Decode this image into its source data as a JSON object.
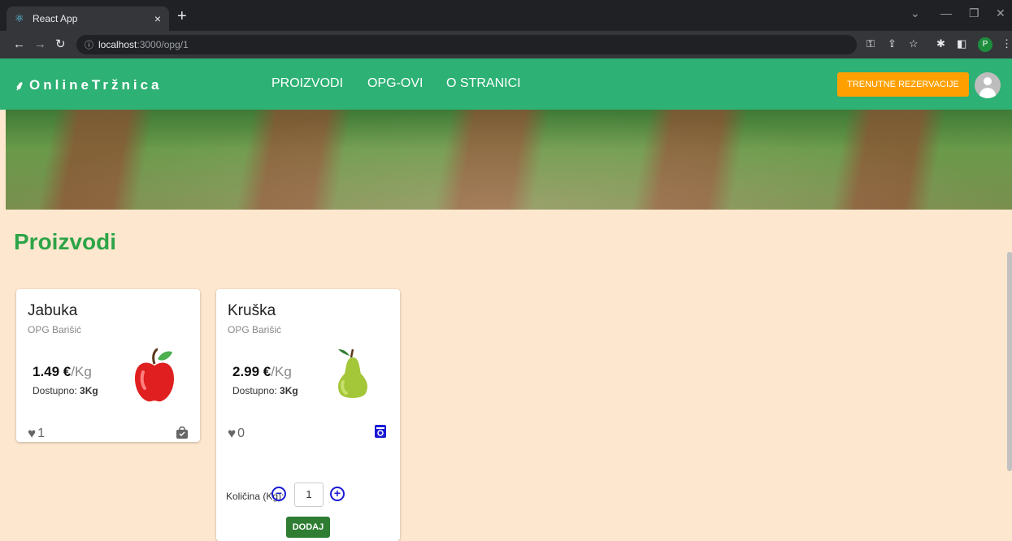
{
  "browser": {
    "tab_title": "React App",
    "tab_close": "×",
    "new_tab": "+",
    "url_host": "localhost",
    "url_path": ":3000/opg/1",
    "profile_initial": "P"
  },
  "nav": {
    "logo": "OnlineTržnica",
    "links": [
      "PROIZVODI",
      "OPG-OVI",
      "O STRANICI"
    ],
    "reserve_button": "TRENUTNE REZERVACIJE"
  },
  "section": {
    "title": "Proizvodi"
  },
  "products": [
    {
      "name": "Jabuka",
      "opg": "OPG Barišić",
      "price": "1.49 €",
      "unit": "/Kg",
      "available_label": "Dostupno:",
      "available_value": "3Kg",
      "likes": "1",
      "fruit_icon": "apple-icon",
      "action_icon": "shopping-bag-icon"
    },
    {
      "name": "Kruška",
      "opg": "OPG Barišić",
      "price": "2.99 €",
      "unit": "/Kg",
      "available_label": "Dostupno:",
      "available_value": "3Kg",
      "likes": "0",
      "fruit_icon": "pear-icon",
      "action_icon": "reservation-icon",
      "quantity_label": "Količina (Kg):",
      "quantity_value": "1",
      "add_button": "DODAJ"
    }
  ],
  "colors": {
    "nav_bg": "#2db174",
    "page_bg": "#fde8cf",
    "reserve_btn": "#ffa000",
    "title_green": "#2da448",
    "add_btn": "#2e7d32",
    "qty_blue": "#1a1ad4"
  }
}
